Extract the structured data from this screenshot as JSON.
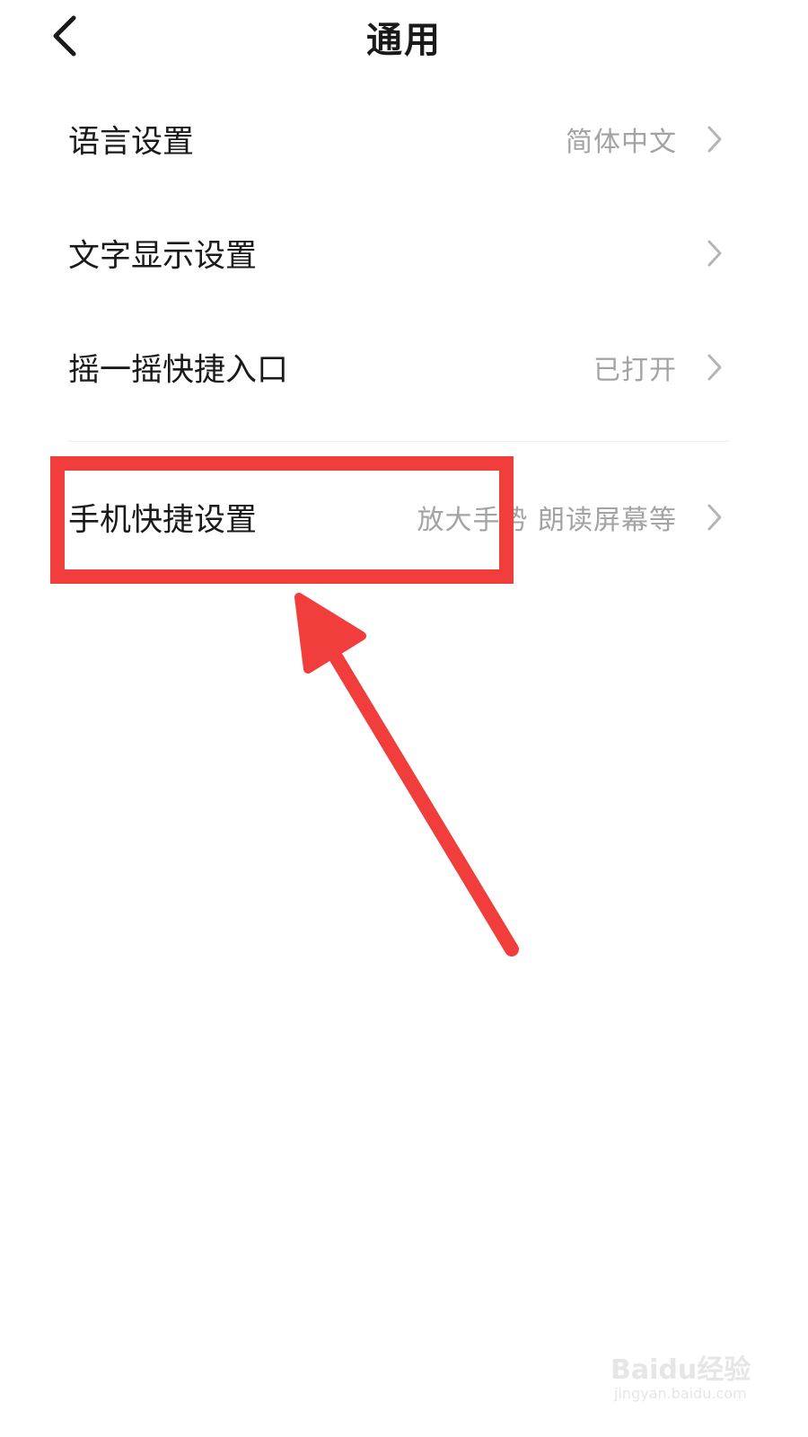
{
  "header": {
    "title": "通用",
    "back_icon": "chevron-left-icon"
  },
  "settings": [
    {
      "label": "语言设置",
      "value": "简体中文"
    },
    {
      "label": "文字显示设置",
      "value": ""
    },
    {
      "label": "摇一摇快捷入口",
      "value": "已打开"
    },
    {
      "label": "手机快捷设置",
      "value": "放大手势 朗读屏幕等"
    }
  ],
  "annotation": {
    "color": "#f23d3d",
    "highlighted_item": "手机快捷设置"
  },
  "watermark": {
    "logo_text": "Baidu经验",
    "url": "jingyan.baidu.com"
  },
  "colors": {
    "primary_text": "#1a1a1a",
    "secondary_text": "#a3a3a3",
    "chevron": "#b5b5b5",
    "annotation_red": "#f23d3d"
  }
}
